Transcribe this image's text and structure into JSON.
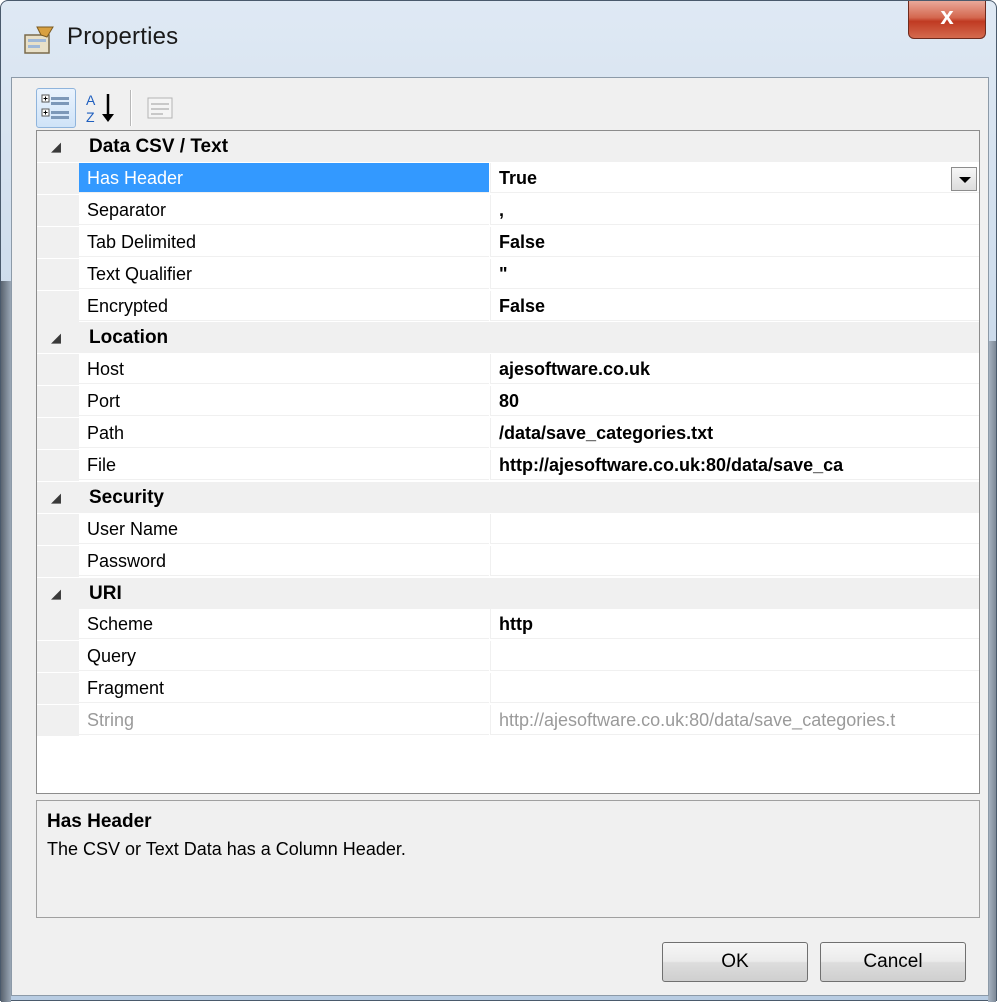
{
  "window": {
    "title": "Properties",
    "close_glyph": "x"
  },
  "toolbar": {
    "categorized_icon": "categorized-icon",
    "alphabetical_icon": "sort-az-icon",
    "property_pages_icon": "property-pages-icon"
  },
  "grid": {
    "categories": [
      {
        "title": "Data CSV / Text",
        "properties": [
          {
            "name": "Has Header",
            "value": "True",
            "selected": true
          },
          {
            "name": "Separator",
            "value": ","
          },
          {
            "name": "Tab Delimited",
            "value": "False"
          },
          {
            "name": "Text Qualifier",
            "value": "\""
          },
          {
            "name": "Encrypted",
            "value": "False"
          }
        ]
      },
      {
        "title": "Location",
        "properties": [
          {
            "name": "Host",
            "value": "ajesoftware.co.uk"
          },
          {
            "name": "Port",
            "value": "80"
          },
          {
            "name": "Path",
            "value": "/data/save_categories.txt"
          },
          {
            "name": "File",
            "value": "http://ajesoftware.co.uk:80/data/save_ca"
          }
        ]
      },
      {
        "title": "Security",
        "properties": [
          {
            "name": "User Name",
            "value": ""
          },
          {
            "name": "Password",
            "value": ""
          }
        ]
      },
      {
        "title": "URI",
        "properties": [
          {
            "name": "Scheme",
            "value": "http"
          },
          {
            "name": "Query",
            "value": ""
          },
          {
            "name": "Fragment",
            "value": ""
          },
          {
            "name": "String",
            "value": "http://ajesoftware.co.uk:80/data/save_categories.t",
            "readonly": true
          }
        ]
      }
    ]
  },
  "description": {
    "title": "Has Header",
    "text": "The CSV or Text Data has a Column Header."
  },
  "buttons": {
    "ok": "OK",
    "cancel": "Cancel"
  },
  "colors": {
    "selection": "#3399ff",
    "close_button": "#c8432b"
  }
}
